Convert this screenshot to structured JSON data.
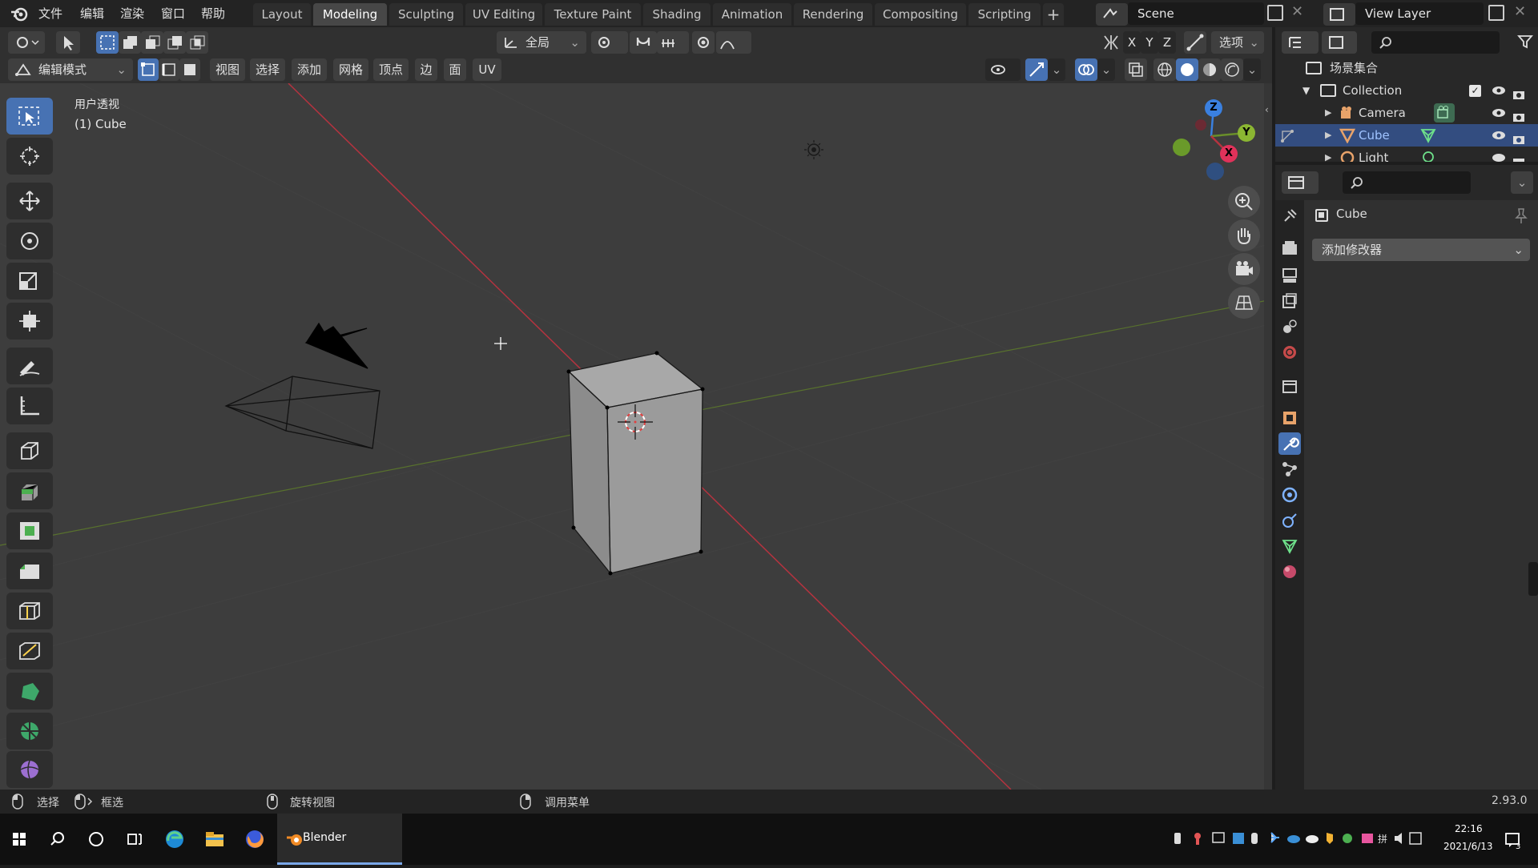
{
  "menu": {
    "file": "文件",
    "edit": "编辑",
    "render": "渲染",
    "window": "窗口",
    "help": "帮助"
  },
  "workspaces": [
    "Layout",
    "Modeling",
    "Sculpting",
    "UV Editing",
    "Texture Paint",
    "Shading",
    "Animation",
    "Rendering",
    "Compositing",
    "Scripting"
  ],
  "active_workspace": "Modeling",
  "scene": {
    "name": "Scene",
    "view_layer": "View Layer"
  },
  "header": {
    "transform_orientation": "全局",
    "axes": [
      "X",
      "Y",
      "Z"
    ],
    "options": "选项",
    "mode": "编辑模式",
    "menus": [
      "视图",
      "选择",
      "添加",
      "网格",
      "顶点",
      "边",
      "面",
      "UV"
    ]
  },
  "viewport": {
    "view_name": "用户透视",
    "object_label": "(1) Cube",
    "gizmo_axes": {
      "z": "Z",
      "y": "Y",
      "x": "X"
    }
  },
  "outliner": {
    "root": "场景集合",
    "collection": "Collection",
    "items": [
      {
        "name": "Camera",
        "selected": false
      },
      {
        "name": "Cube",
        "selected": true
      },
      {
        "name": "Light",
        "selected": false
      }
    ]
  },
  "properties": {
    "object_name": "Cube",
    "add_modifier": "添加修改器"
  },
  "status": {
    "select": "选择",
    "box_select": "框选",
    "rotate_view": "旋转视图",
    "call_menu": "调用菜单",
    "version": "2.93.0"
  },
  "taskbar": {
    "app": "Blender",
    "time": "22:16",
    "date": "2021/6/13"
  },
  "colors": {
    "accent": "#4772b3",
    "x_axis": "#b5333f",
    "y_axis": "#6a8f2a",
    "z_axis": "#3a80e0"
  }
}
